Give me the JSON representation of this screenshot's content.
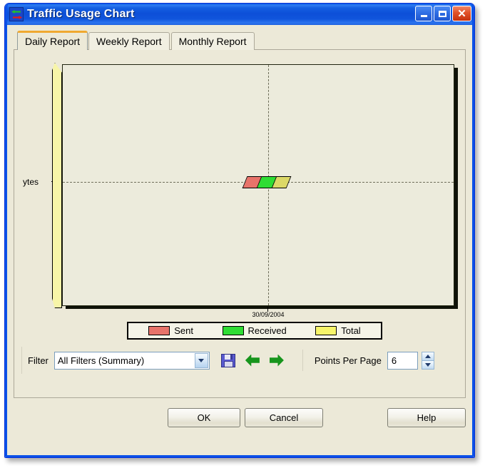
{
  "window": {
    "title": "Traffic Usage Chart",
    "icon": "traffic-arrows-icon",
    "controls": {
      "minimize": "minimize-icon",
      "maximize": "maximize-icon",
      "close": "close-icon"
    }
  },
  "tabs": [
    {
      "label": "Daily Report",
      "active": true
    },
    {
      "label": "Weekly Report",
      "active": false
    },
    {
      "label": "Monthly Report",
      "active": false
    }
  ],
  "chart_data": {
    "type": "bar",
    "title": "",
    "subtitle": "",
    "xlabel": "",
    "ylabel": "ytes",
    "categories": [
      "30/09/2004"
    ],
    "tick_labels_x": [
      "30/09/2004"
    ],
    "tick_labels_y": [
      ""
    ],
    "grid": true,
    "legend_position": "bottom",
    "series": [
      {
        "name": "Sent",
        "color": "#e8736a",
        "values": [
          0
        ]
      },
      {
        "name": "Received",
        "color": "#2fdd34",
        "values": [
          0
        ]
      },
      {
        "name": "Total",
        "color": "#f7f56a",
        "values": [
          0
        ]
      }
    ],
    "legend": [
      "Sent",
      "Received",
      "Total"
    ],
    "annotations": [
      "Values at or near zero; bars render as a flat 3D sliver on the baseline"
    ]
  },
  "controls": {
    "filter_label": "Filter",
    "filter_value": "All Filters (Summary)",
    "filter_options": [
      "All Filters (Summary)"
    ],
    "save_icon": "save-floppy-icon",
    "prev_icon": "arrow-left-icon",
    "next_icon": "arrow-right-icon",
    "points_per_page_label": "Points Per Page",
    "points_per_page_value": "6",
    "spinner_up": "spinner-up-icon",
    "spinner_down": "spinner-down-icon"
  },
  "buttons": {
    "ok": "OK",
    "cancel": "Cancel",
    "help": "Help"
  },
  "colors": {
    "titlebar": "#0a51e8",
    "window_bg": "#ece9d8",
    "plot_bg": "#ecebdc",
    "wall": "#f7f5a8",
    "tab_accent": "#f0a930",
    "sent": "#e8736a",
    "received": "#2fdd34",
    "total": "#f7f56a"
  }
}
